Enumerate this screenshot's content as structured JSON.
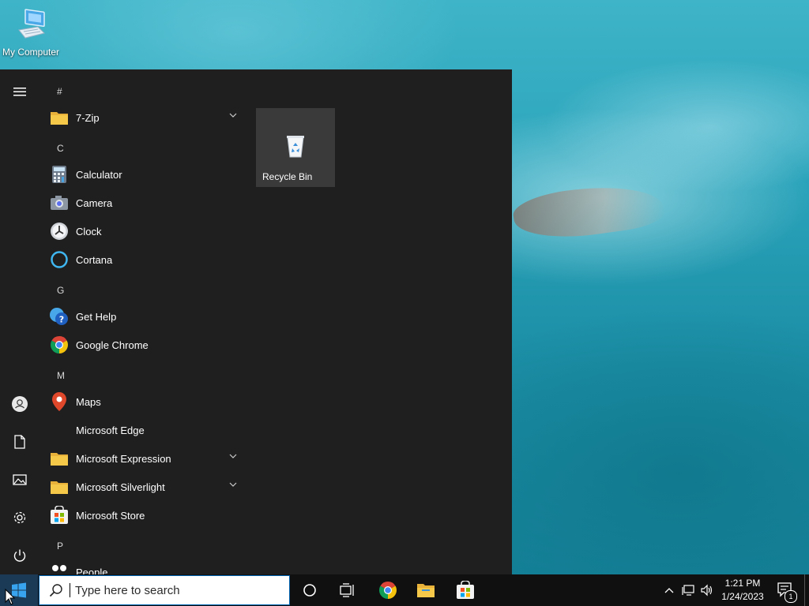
{
  "desktop": {
    "icons": [
      {
        "label": "My Computer",
        "icon": "computer-icon"
      }
    ]
  },
  "start_menu": {
    "rail": {
      "items": [
        {
          "icon": "hamburger-menu-icon"
        },
        {
          "icon": "user-account-icon"
        },
        {
          "icon": "documents-icon"
        },
        {
          "icon": "pictures-icon"
        },
        {
          "icon": "settings-gear-icon"
        },
        {
          "icon": "power-icon"
        }
      ]
    },
    "groups": [
      {
        "letter": "#",
        "apps": [
          {
            "name": "7-Zip",
            "icon": "folder-icon",
            "expandable": true
          }
        ]
      },
      {
        "letter": "C",
        "apps": [
          {
            "name": "Calculator",
            "icon": "calculator-icon"
          },
          {
            "name": "Camera",
            "icon": "camera-icon"
          },
          {
            "name": "Clock",
            "icon": "clock-icon"
          },
          {
            "name": "Cortana",
            "icon": "cortana-icon"
          }
        ]
      },
      {
        "letter": "G",
        "apps": [
          {
            "name": "Get Help",
            "icon": "get-help-icon"
          },
          {
            "name": "Google Chrome",
            "icon": "chrome-icon"
          }
        ]
      },
      {
        "letter": "M",
        "apps": [
          {
            "name": "Maps",
            "icon": "maps-pin-icon"
          },
          {
            "name": "Microsoft Edge",
            "icon": ""
          },
          {
            "name": "Microsoft Expression",
            "icon": "folder-icon",
            "expandable": true
          },
          {
            "name": "Microsoft Silverlight",
            "icon": "folder-icon",
            "expandable": true
          },
          {
            "name": "Microsoft Store",
            "icon": "store-icon"
          }
        ]
      },
      {
        "letter": "P",
        "apps": [
          {
            "name": "People",
            "icon": "people-icon"
          }
        ]
      }
    ],
    "tiles": [
      {
        "label": "Recycle Bin",
        "icon": "recycle-bin-icon"
      }
    ]
  },
  "taskbar": {
    "search_placeholder": "Type here to search",
    "pinned": [
      {
        "icon": "cortana-circle-icon"
      },
      {
        "icon": "task-view-icon"
      },
      {
        "icon": "chrome-icon"
      },
      {
        "icon": "file-explorer-icon"
      },
      {
        "icon": "store-icon"
      }
    ],
    "tray": {
      "time": "1:21 PM",
      "date": "1/24/2023",
      "notifications_count": "1"
    }
  },
  "colors": {
    "start_menu_bg": "#1f1f1f",
    "tile_bg": "#3a3a3a",
    "taskbar_bg": "#101010",
    "accent": "#0078d7",
    "folder_yellow": "#f4c542"
  }
}
